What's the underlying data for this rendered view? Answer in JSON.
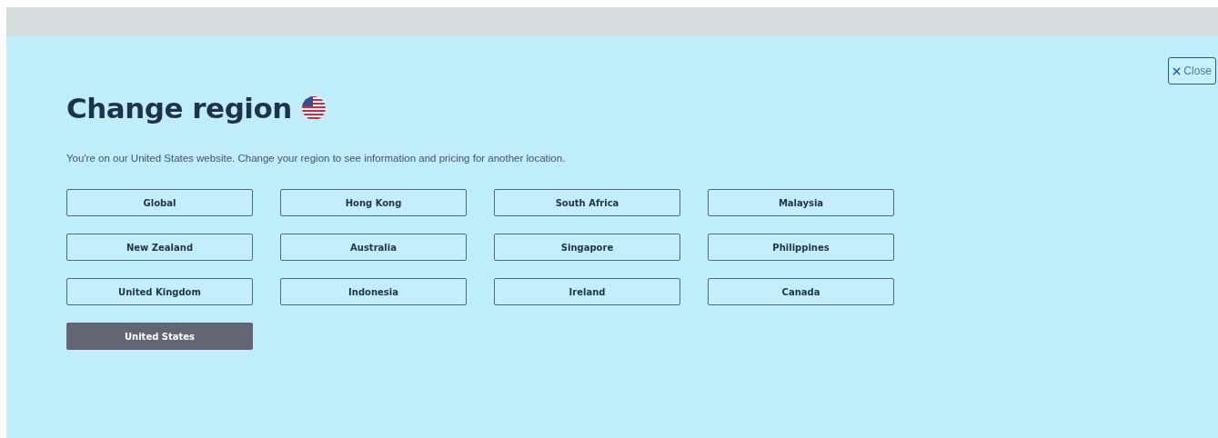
{
  "close_button": {
    "label": "Close"
  },
  "title": "Change region",
  "description": "You're on our United States website. Change your region to see information and pricing for another location.",
  "regions": [
    {
      "label": "Global",
      "selected": false
    },
    {
      "label": "Hong Kong",
      "selected": false
    },
    {
      "label": "South Africa",
      "selected": false
    },
    {
      "label": "Malaysia",
      "selected": false
    },
    {
      "label": "New Zealand",
      "selected": false
    },
    {
      "label": "Australia",
      "selected": false
    },
    {
      "label": "Singapore",
      "selected": false
    },
    {
      "label": "Philippines",
      "selected": false
    },
    {
      "label": "United Kingdom",
      "selected": false
    },
    {
      "label": "Indonesia",
      "selected": false
    },
    {
      "label": "Ireland",
      "selected": false
    },
    {
      "label": "Canada",
      "selected": false
    },
    {
      "label": "United States",
      "selected": true
    }
  ]
}
